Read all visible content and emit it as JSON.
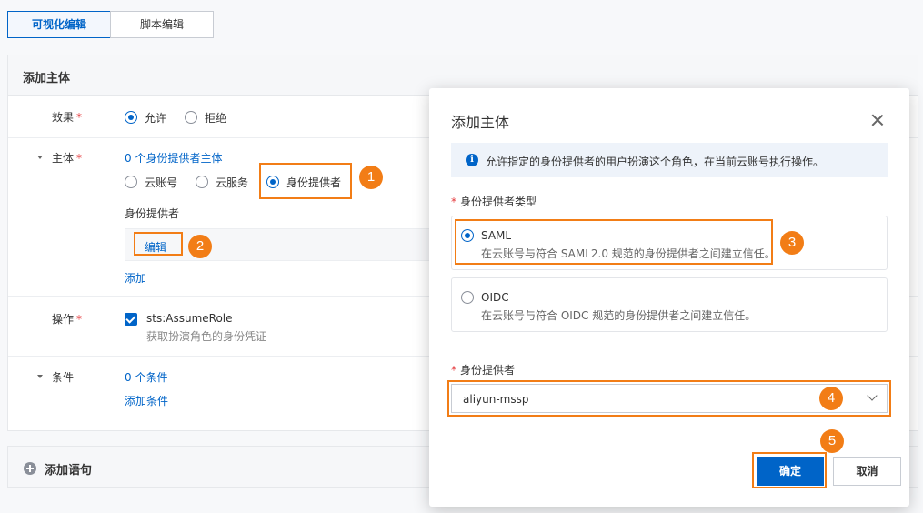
{
  "tabs": [
    {
      "label": "可视化编辑",
      "active": true
    },
    {
      "label": "脚本编辑",
      "active": false
    }
  ],
  "panel": {
    "title": "添加主体",
    "effect": {
      "label": "效果",
      "required": "*",
      "options": [
        "允许",
        "拒绝"
      ],
      "selected": "允许"
    },
    "principal": {
      "label": "主体",
      "required": "*",
      "summary": "0 个身份提供者主体",
      "options": [
        "云账号",
        "云服务",
        "身份提供者"
      ],
      "selected": "身份提供者",
      "provider_label": "身份提供者",
      "edit_label": "编辑",
      "add_label": "添加"
    },
    "action": {
      "label": "操作",
      "required": "*",
      "value": "sts:AssumeRole",
      "desc": "获取扮演角色的身份凭证"
    },
    "condition": {
      "label": "条件",
      "summary": "0 个条件",
      "add_label": "添加条件"
    }
  },
  "add_statement": "添加语句",
  "dialog": {
    "title": "添加主体",
    "info": "允许指定的身份提供者的用户扮演这个角色，在当前云账号执行操作。",
    "type_label": "身份提供者类型",
    "required": "*",
    "options": [
      {
        "title": "SAML",
        "desc": "在云账号与符合 SAML2.0 规范的身份提供者之间建立信任。",
        "selected": true
      },
      {
        "title": "OIDC",
        "desc": "在云账号与符合 OIDC 规范的身份提供者之间建立信任。",
        "selected": false
      }
    ],
    "provider_label": "身份提供者",
    "provider_value": "aliyun-mssp",
    "confirm": "确定",
    "cancel": "取消"
  },
  "steps": [
    "1",
    "2",
    "3",
    "4",
    "5"
  ],
  "colors": {
    "accent": "#0064c8",
    "highlight": "#f27d16"
  }
}
